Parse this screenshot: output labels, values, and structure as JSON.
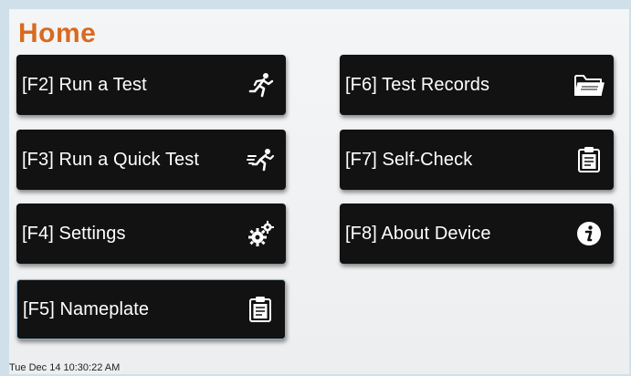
{
  "screen": {
    "title": "Home",
    "title_color": "#d86a1f",
    "tile_color": "#121212"
  },
  "tiles": [
    {
      "label": "[F2] Run a Test",
      "icon": "running-person-icon"
    },
    {
      "label": "[F3] Run a Quick Test",
      "icon": "sprinting-person-icon"
    },
    {
      "label": "[F4] Settings",
      "icon": "gears-icon"
    },
    {
      "label": "[F5] Nameplate",
      "icon": "clipboard-icon"
    },
    {
      "label": "[F6] Test Records",
      "icon": "folder-icon"
    },
    {
      "label": "[F7] Self-Check",
      "icon": "clipboard-icon"
    },
    {
      "label": "[F8] About Device",
      "icon": "info-icon"
    }
  ],
  "status_bar": {
    "datetime": "Tue Dec 14   10:30:22 AM"
  }
}
